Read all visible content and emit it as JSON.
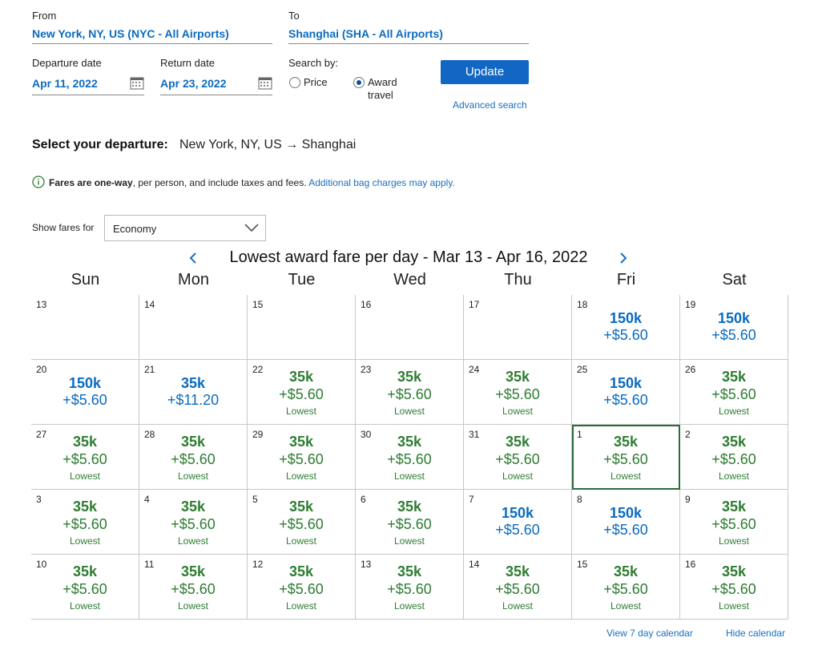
{
  "search": {
    "from_label": "From",
    "from_value": "New York, NY, US (NYC - All Airports)",
    "to_label": "To",
    "to_value": "Shanghai (SHA - All Airports)",
    "departure_label": "Departure date",
    "departure_value": "Apr 11, 2022",
    "return_label": "Return date",
    "return_value": "Apr 23, 2022",
    "search_by_label": "Search by:",
    "price_label": "Price",
    "award_label_1": "Award",
    "award_label_2": "travel",
    "selected_mode": "award",
    "update_label": "Update",
    "advanced_label": "Advanced search"
  },
  "departure": {
    "heading": "Select your departure:",
    "route": "New York, NY, US → Shanghai"
  },
  "notice": {
    "bold": "Fares are one-way",
    "text": ", per person, and include taxes and fees.",
    "link": "Additional bag charges may apply."
  },
  "fares_filter": {
    "label": "Show fares for",
    "value": "Economy"
  },
  "calendar": {
    "title": "Lowest award fare per day - Mar 13 - Apr 16, 2022",
    "weekdays": [
      "Sun",
      "Mon",
      "Tue",
      "Wed",
      "Thu",
      "Fri",
      "Sat"
    ],
    "lowest_label": "Lowest",
    "selected_day": "1",
    "days": [
      {
        "day": "13"
      },
      {
        "day": "14"
      },
      {
        "day": "15"
      },
      {
        "day": "16"
      },
      {
        "day": "17"
      },
      {
        "day": "18",
        "miles": "150k",
        "tax": "+$5.60",
        "lowest": false
      },
      {
        "day": "19",
        "miles": "150k",
        "tax": "+$5.60",
        "lowest": false
      },
      {
        "day": "20",
        "miles": "150k",
        "tax": "+$5.60",
        "lowest": false
      },
      {
        "day": "21",
        "miles": "35k",
        "tax": "+$11.20",
        "lowest": false
      },
      {
        "day": "22",
        "miles": "35k",
        "tax": "+$5.60",
        "lowest": true
      },
      {
        "day": "23",
        "miles": "35k",
        "tax": "+$5.60",
        "lowest": true
      },
      {
        "day": "24",
        "miles": "35k",
        "tax": "+$5.60",
        "lowest": true
      },
      {
        "day": "25",
        "miles": "150k",
        "tax": "+$5.60",
        "lowest": false
      },
      {
        "day": "26",
        "miles": "35k",
        "tax": "+$5.60",
        "lowest": true
      },
      {
        "day": "27",
        "miles": "35k",
        "tax": "+$5.60",
        "lowest": true
      },
      {
        "day": "28",
        "miles": "35k",
        "tax": "+$5.60",
        "lowest": true
      },
      {
        "day": "29",
        "miles": "35k",
        "tax": "+$5.60",
        "lowest": true
      },
      {
        "day": "30",
        "miles": "35k",
        "tax": "+$5.60",
        "lowest": true
      },
      {
        "day": "31",
        "miles": "35k",
        "tax": "+$5.60",
        "lowest": true
      },
      {
        "day": "1",
        "miles": "35k",
        "tax": "+$5.60",
        "lowest": true
      },
      {
        "day": "2",
        "miles": "35k",
        "tax": "+$5.60",
        "lowest": true
      },
      {
        "day": "3",
        "miles": "35k",
        "tax": "+$5.60",
        "lowest": true
      },
      {
        "day": "4",
        "miles": "35k",
        "tax": "+$5.60",
        "lowest": true
      },
      {
        "day": "5",
        "miles": "35k",
        "tax": "+$5.60",
        "lowest": true
      },
      {
        "day": "6",
        "miles": "35k",
        "tax": "+$5.60",
        "lowest": true
      },
      {
        "day": "7",
        "miles": "150k",
        "tax": "+$5.60",
        "lowest": false
      },
      {
        "day": "8",
        "miles": "150k",
        "tax": "+$5.60",
        "lowest": false
      },
      {
        "day": "9",
        "miles": "35k",
        "tax": "+$5.60",
        "lowest": true
      },
      {
        "day": "10",
        "miles": "35k",
        "tax": "+$5.60",
        "lowest": true
      },
      {
        "day": "11",
        "miles": "35k",
        "tax": "+$5.60",
        "lowest": true
      },
      {
        "day": "12",
        "miles": "35k",
        "tax": "+$5.60",
        "lowest": true
      },
      {
        "day": "13",
        "miles": "35k",
        "tax": "+$5.60",
        "lowest": true
      },
      {
        "day": "14",
        "miles": "35k",
        "tax": "+$5.60",
        "lowest": true
      },
      {
        "day": "15",
        "miles": "35k",
        "tax": "+$5.60",
        "lowest": true
      },
      {
        "day": "16",
        "miles": "35k",
        "tax": "+$5.60",
        "lowest": true
      }
    ]
  },
  "footer": {
    "view7_label": "View 7 day calendar",
    "hide_label": "Hide calendar"
  },
  "colors": {
    "link_blue": "#1a6fc0",
    "fare_blue": "#0b6bc0",
    "fare_green": "#2e7d32",
    "button_blue": "#1267c4"
  }
}
